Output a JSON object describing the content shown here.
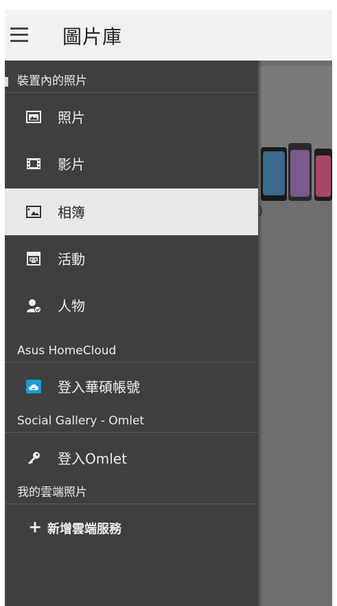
{
  "app_bar": {
    "title": "圖片庫",
    "menu_icon": "hamburger-menu-icon"
  },
  "drawer": {
    "section_device": {
      "label": "裝置內的照片"
    },
    "items": [
      {
        "label": "照片",
        "icon": "photo-icon"
      },
      {
        "label": "影片",
        "icon": "film-icon"
      },
      {
        "label": "相簿",
        "icon": "album-icon",
        "selected": true
      },
      {
        "label": "活動",
        "icon": "calendar-event-icon"
      },
      {
        "label": "人物",
        "icon": "person-icon"
      }
    ],
    "section_homecloud": {
      "label": "Asus HomeCloud"
    },
    "homecloud_item": {
      "label": "登入華碩帳號",
      "icon": "cloud-home-icon"
    },
    "section_omlet": {
      "label": "Social Gallery - Omlet"
    },
    "omlet_item": {
      "label": "登入Omlet",
      "icon": "key-icon"
    },
    "section_cloud": {
      "label": "我的雲端照片"
    },
    "add_cloud": {
      "plus": "+",
      "label": "新增雲端服務"
    }
  },
  "background": {
    "paren_text": ")"
  },
  "colors": {
    "drawer_bg": "#3f3f3f",
    "selected_bg": "#e8e8e8",
    "appbar_bg": "#f1f1f1",
    "accent_blue": "#1e9bd7"
  }
}
